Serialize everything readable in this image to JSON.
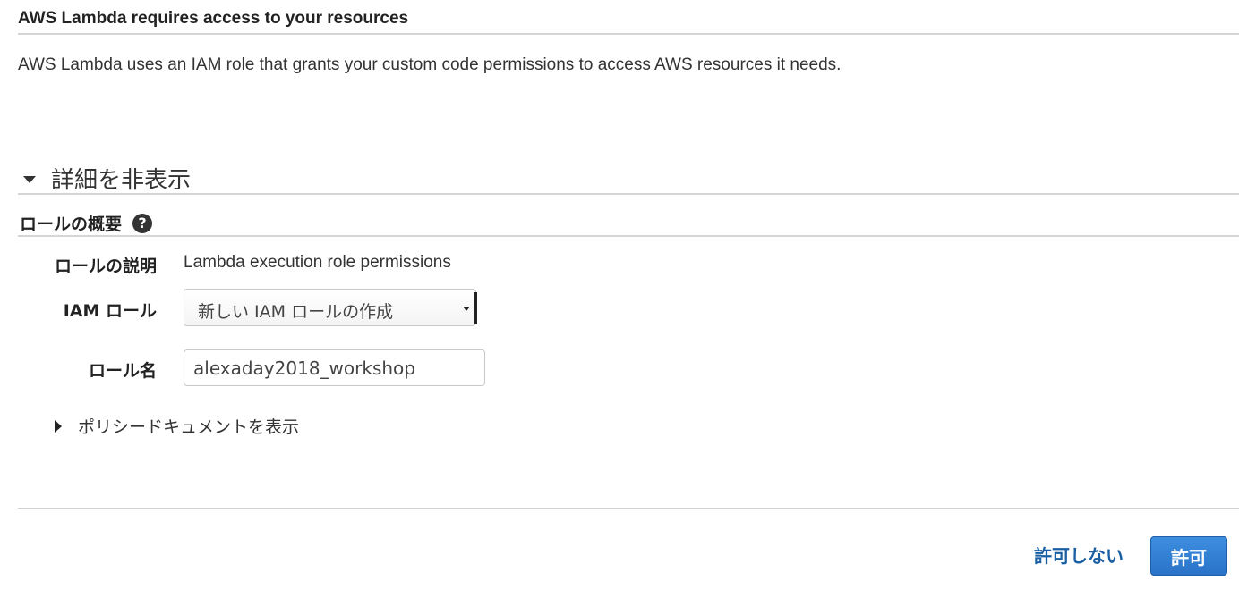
{
  "header": {
    "title": "AWS Lambda requires access to your resources"
  },
  "description": "AWS Lambda uses an IAM role that grants your custom code permissions to access AWS resources it needs.",
  "details_toggle": {
    "label": "詳細を非表示",
    "icon": "triangle-down-icon"
  },
  "role_summary": {
    "title": "ロールの概要",
    "help_icon": "?",
    "fields": {
      "description_label": "ロールの説明",
      "description_value": "Lambda execution role permissions",
      "iam_role_label": "IAM ロール",
      "iam_role_selected": "新しい IAM ロールの作成",
      "role_name_label": "ロール名",
      "role_name_value": "alexaday2018_workshop"
    },
    "policy_toggle": {
      "label": "ポリシードキュメントを表示",
      "icon": "triangle-right-icon"
    }
  },
  "footer": {
    "deny_label": "許可しない",
    "allow_label": "許可"
  },
  "colors": {
    "link": "#1a5fa3",
    "primary_button": "#2a73c8",
    "divider": "#d5d5d5"
  }
}
